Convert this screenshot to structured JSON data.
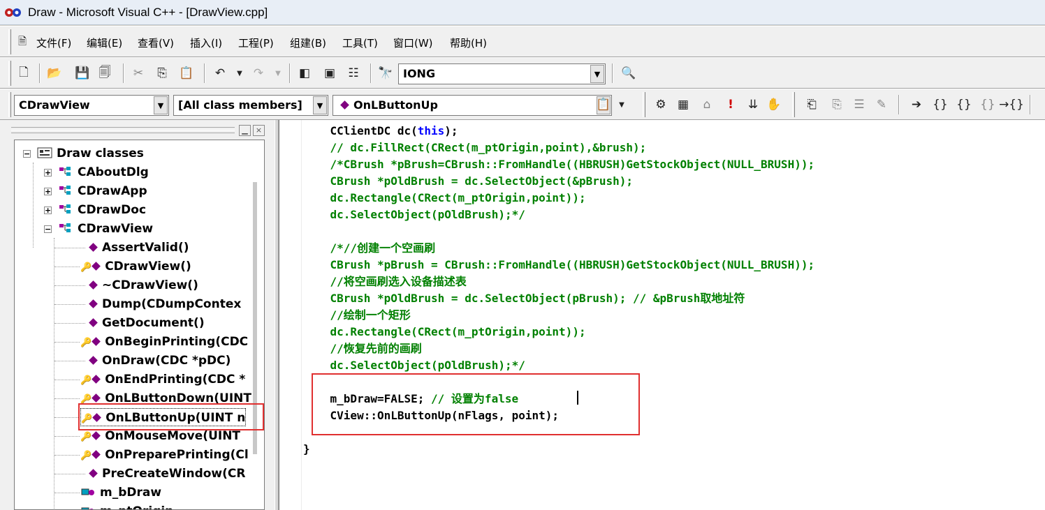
{
  "window": {
    "title": "Draw - Microsoft Visual C++ - [DrawView.cpp]"
  },
  "menu": [
    {
      "label": "文件(F)"
    },
    {
      "label": "编辑(E)"
    },
    {
      "label": "查看(V)"
    },
    {
      "label": "插入(I)"
    },
    {
      "label": "工程(P)"
    },
    {
      "label": "组建(B)"
    },
    {
      "label": "工具(T)"
    },
    {
      "label": "窗口(W)"
    },
    {
      "label": "帮助(H)"
    }
  ],
  "toolbar": {
    "find_combo": "IONG"
  },
  "wizardbar": {
    "class_combo": "CDrawView",
    "filter_combo": "[All class members]",
    "member_combo": "OnLButtonUp"
  },
  "classview": {
    "root": "Draw classes",
    "classes": [
      "CAboutDlg",
      "CDrawApp",
      "CDrawDoc",
      "CDrawView"
    ],
    "members": [
      {
        "label": "AssertValid()",
        "type": "method"
      },
      {
        "label": "CDrawView()",
        "type": "method-key"
      },
      {
        "label": "~CDrawView()",
        "type": "method"
      },
      {
        "label": "Dump(CDumpContex",
        "type": "method"
      },
      {
        "label": "GetDocument()",
        "type": "method"
      },
      {
        "label": "OnBeginPrinting(CDC",
        "type": "method-key"
      },
      {
        "label": "OnDraw(CDC *pDC)",
        "type": "method"
      },
      {
        "label": "OnEndPrinting(CDC *",
        "type": "method-key"
      },
      {
        "label": "OnLButtonDown(UINT",
        "type": "method-key"
      },
      {
        "label": "OnLButtonUp(UINT n",
        "type": "method-key",
        "selected": true
      },
      {
        "label": "OnMouseMove(UINT",
        "type": "method-key"
      },
      {
        "label": "OnPreparePrinting(Cl",
        "type": "method-key"
      },
      {
        "label": "PreCreateWindow(CR",
        "type": "method"
      },
      {
        "label": "m_bDraw",
        "type": "variable"
      },
      {
        "label": "m_ptOrigin",
        "type": "variable"
      }
    ]
  },
  "code": {
    "lines": [
      {
        "segments": [
          {
            "t": "    CClientDC dc(",
            "c": "normal"
          },
          {
            "t": "this",
            "c": "kw"
          },
          {
            "t": ");",
            "c": "normal"
          }
        ]
      },
      {
        "segments": [
          {
            "t": "    // dc.FillRect(CRect(m_ptOrigin,point),&brush);",
            "c": "comment"
          }
        ]
      },
      {
        "segments": [
          {
            "t": "    /*CBrush *pBrush=CBrush::FromHandle((HBRUSH)GetStockObject(NULL_BRUSH));",
            "c": "comment"
          }
        ]
      },
      {
        "segments": [
          {
            "t": "    CBrush *pOldBrush = dc.SelectObject(&pBrush);",
            "c": "comment"
          }
        ]
      },
      {
        "segments": [
          {
            "t": "    dc.Rectangle(CRect(m_ptOrigin,point));",
            "c": "comment"
          }
        ]
      },
      {
        "segments": [
          {
            "t": "    dc.SelectObject(pOldBrush);*/",
            "c": "comment"
          }
        ]
      },
      {
        "segments": [
          {
            "t": "",
            "c": "normal"
          }
        ]
      },
      {
        "segments": [
          {
            "t": "    /*//创建一个空画刷",
            "c": "comment"
          }
        ]
      },
      {
        "segments": [
          {
            "t": "    CBrush *pBrush = CBrush::FromHandle((HBRUSH)GetStockObject(NULL_BRUSH));",
            "c": "comment"
          }
        ]
      },
      {
        "segments": [
          {
            "t": "    //将空画刷选入设备描述表",
            "c": "comment"
          }
        ]
      },
      {
        "segments": [
          {
            "t": "    CBrush *pOldBrush = dc.SelectObject(pBrush); // &pBrush取地址符",
            "c": "comment"
          }
        ]
      },
      {
        "segments": [
          {
            "t": "    //绘制一个矩形",
            "c": "comment"
          }
        ]
      },
      {
        "segments": [
          {
            "t": "    dc.Rectangle(CRect(m_ptOrigin,point));",
            "c": "comment"
          }
        ]
      },
      {
        "segments": [
          {
            "t": "    //恢复先前的画刷",
            "c": "comment"
          }
        ]
      },
      {
        "segments": [
          {
            "t": "    dc.SelectObject(pOldBrush);*/",
            "c": "comment"
          }
        ]
      },
      {
        "segments": [
          {
            "t": "",
            "c": "normal"
          }
        ]
      },
      {
        "segments": [
          {
            "t": "    m_bDraw=FALSE; ",
            "c": "normal"
          },
          {
            "t": "// 设置为false",
            "c": "comment"
          }
        ]
      },
      {
        "segments": [
          {
            "t": "    CView::OnLButtonUp(nFlags, point);",
            "c": "normal"
          }
        ]
      },
      {
        "segments": [
          {
            "t": "",
            "c": "normal"
          }
        ]
      },
      {
        "segments": [
          {
            "t": "}",
            "c": "normal"
          }
        ]
      }
    ]
  },
  "colors": {
    "comment": "#008000",
    "keyword": "#0000ff",
    "highlight_box": "#e03030"
  }
}
